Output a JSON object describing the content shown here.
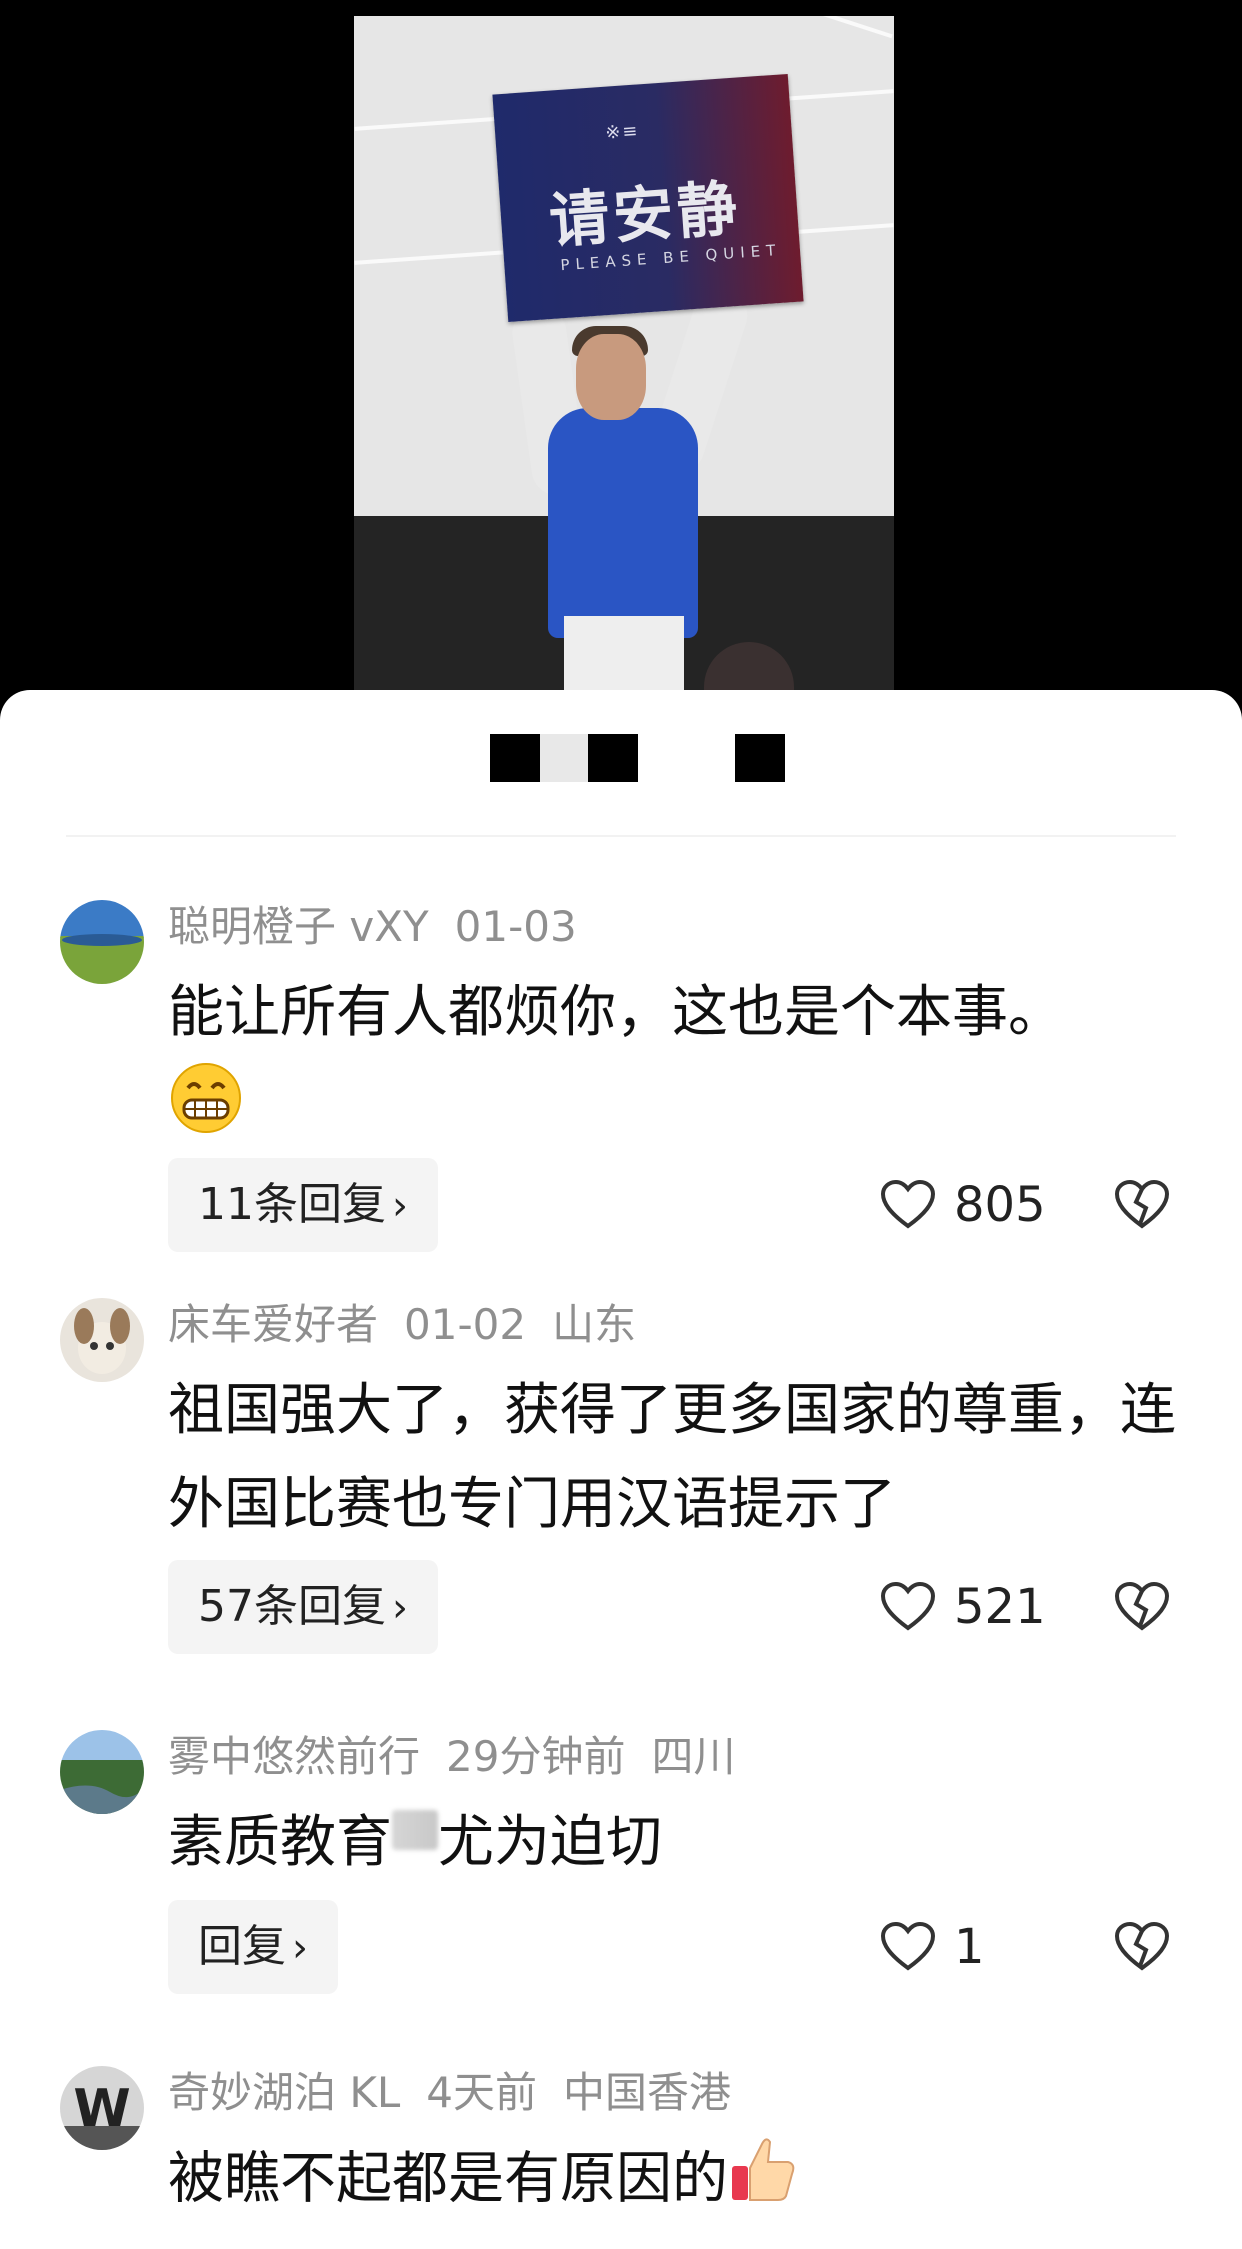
{
  "video": {
    "sign_logo": "※≡",
    "sign_title": "请安静",
    "sign_subtitle": "PLEASE  BE QUIET"
  },
  "comments": [
    {
      "username": "聪明橙子 vXY",
      "date": "01-03",
      "location": "",
      "text": "能让所有人都烦你，这也是个本事。",
      "emoji": "grinning-face",
      "reply_label": "11条回复",
      "likes": "805"
    },
    {
      "username": "床车爱好者",
      "date": "01-02",
      "location": "山东",
      "text": "祖国强大了，获得了更多国家的尊重，连外国比赛也专门用汉语提示了",
      "reply_label": "57条回复",
      "likes": "521"
    },
    {
      "username": "雾中悠然前行",
      "date": "29分钟前",
      "location": "四川",
      "text_before": "素质教育",
      "text_after": "尤为迫切",
      "reply_label": "回复",
      "likes": "1"
    },
    {
      "username": "奇妙湖泊 KL",
      "date": "4天前",
      "location": "中国香港",
      "text": "被瞧不起都是有原因的",
      "emoji": "thumbs-up"
    }
  ],
  "icons": {
    "like": "heart-outline-icon",
    "dislike": "broken-heart-icon",
    "chevron": "chevron-right-icon"
  },
  "colors": {
    "meta_text": "#8f8f8f",
    "reply_bg": "#f4f4f4",
    "sheet_bg": "#ffffff"
  }
}
